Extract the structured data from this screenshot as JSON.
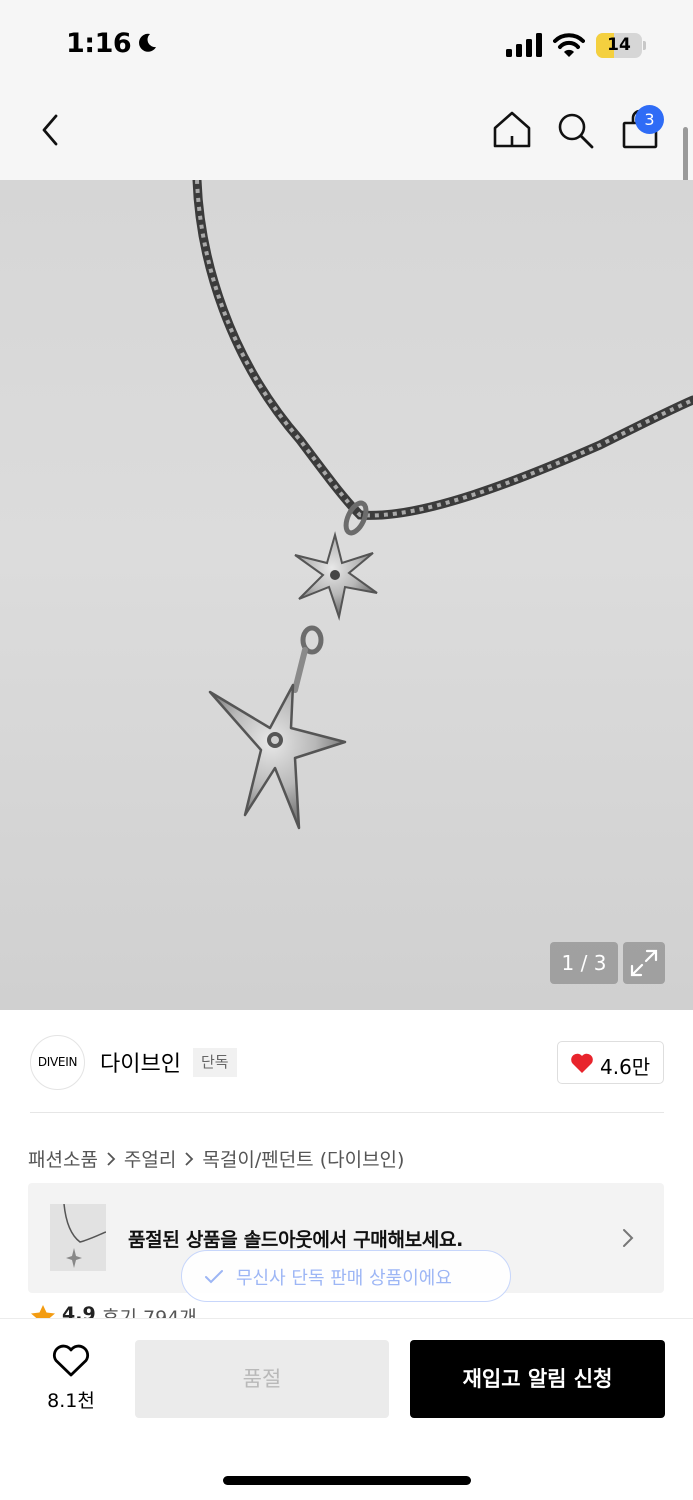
{
  "status_bar": {
    "time": "1:16",
    "battery": "14",
    "battery_level_percent": 14
  },
  "nav": {
    "icons": [
      "back-icon",
      "home-icon",
      "search-icon",
      "shopping-bag-icon"
    ],
    "cart_count": "3"
  },
  "product_image": {
    "counter": "1 / 3"
  },
  "brand": {
    "logo_text": "DIVEIN",
    "name": "다이브인",
    "tag": "단독",
    "likes": "4.6만"
  },
  "breadcrumb": {
    "items": [
      "패션소품",
      "주얼리",
      "목걸이/펜던트 (다이브인)"
    ]
  },
  "soldout_banner": {
    "text": "품절된 상품을 솔드아웃에서 구매해보세요."
  },
  "exclusive_pill": {
    "text": "무신사 단독 판매 상품이에요"
  },
  "rating": {
    "score": "4.9",
    "reviews": "후기 794개"
  },
  "bottom_bar": {
    "wish_count": "8.1천",
    "soldout_label": "품절",
    "restock_label": "재입고 알림 신청"
  },
  "colors": {
    "accent_blue": "#2f6cf6",
    "heart_red": "#e8242c",
    "star_orange": "#f39c12",
    "primary_button": "#000000"
  }
}
